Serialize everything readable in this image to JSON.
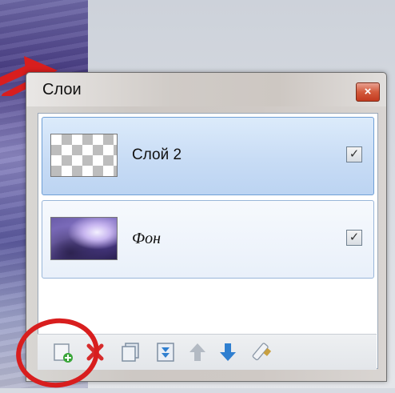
{
  "window": {
    "title": "Слои",
    "close_label": "×"
  },
  "layers": [
    {
      "name": "Слой 2",
      "visible": true,
      "selected": true,
      "thumbnail": "transparent-checker"
    },
    {
      "name": "Фон",
      "visible": true,
      "selected": false,
      "thumbnail": "purple-landscape"
    }
  ],
  "checkbox_mark": "✓",
  "toolbar": {
    "buttons": [
      {
        "name": "add-layer-icon",
        "color": "#3aa63a"
      },
      {
        "name": "delete-layer-icon",
        "color": "#d62b2b"
      },
      {
        "name": "duplicate-layer-icon",
        "color": "#7aa0c8"
      },
      {
        "name": "merge-layer-down-icon",
        "color": "#2f7fd0"
      },
      {
        "name": "move-layer-up-icon",
        "color": "#9aa3ad"
      },
      {
        "name": "move-layer-down-icon",
        "color": "#2f7fd0"
      },
      {
        "name": "layer-properties-icon",
        "color": "#c8a040"
      }
    ]
  },
  "annotations": {
    "arrow_color": "#d81e1e",
    "circle_color": "#d81e1e"
  }
}
